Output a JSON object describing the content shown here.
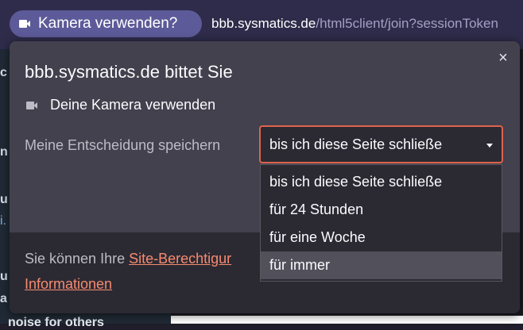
{
  "urlbar": {
    "permission_pill_label": "Kamera verwenden?",
    "url_domain": "bbb.sysmatics.de",
    "url_path": "/html5client/join?sessionToken"
  },
  "background_page": {
    "fragments": [
      "c",
      "n",
      "u",
      "i.",
      "u",
      "a"
    ],
    "bottom_text": "noise for others"
  },
  "popup": {
    "title": "bbb.sysmatics.de bittet Sie",
    "close_label": "×",
    "permission_label": "Deine Kamera verwenden",
    "remember_label": "Meine Entscheidung speichern",
    "selected_option": "bis ich diese Seite schließe",
    "options": [
      "bis ich diese Seite schließe",
      "für 24 Stunden",
      "für eine Woche",
      "für immer"
    ],
    "highlighted_option_index": 3,
    "footer_text": "Sie können Ihre ",
    "footer_link": "Site-Berechtigungen",
    "footer_link_visible": "Site-Berechtigur",
    "footer_link2": "Informationen"
  },
  "colors": {
    "urlbar_bg": "#2e2c4a",
    "pill_bg": "#5d5a99",
    "popup_bg": "#42414d",
    "select_border": "#e0624b",
    "link": "#f88a6f"
  },
  "icons": {
    "camera": "camera-icon",
    "close": "close-icon",
    "dropdown": "chevron-down-icon"
  }
}
